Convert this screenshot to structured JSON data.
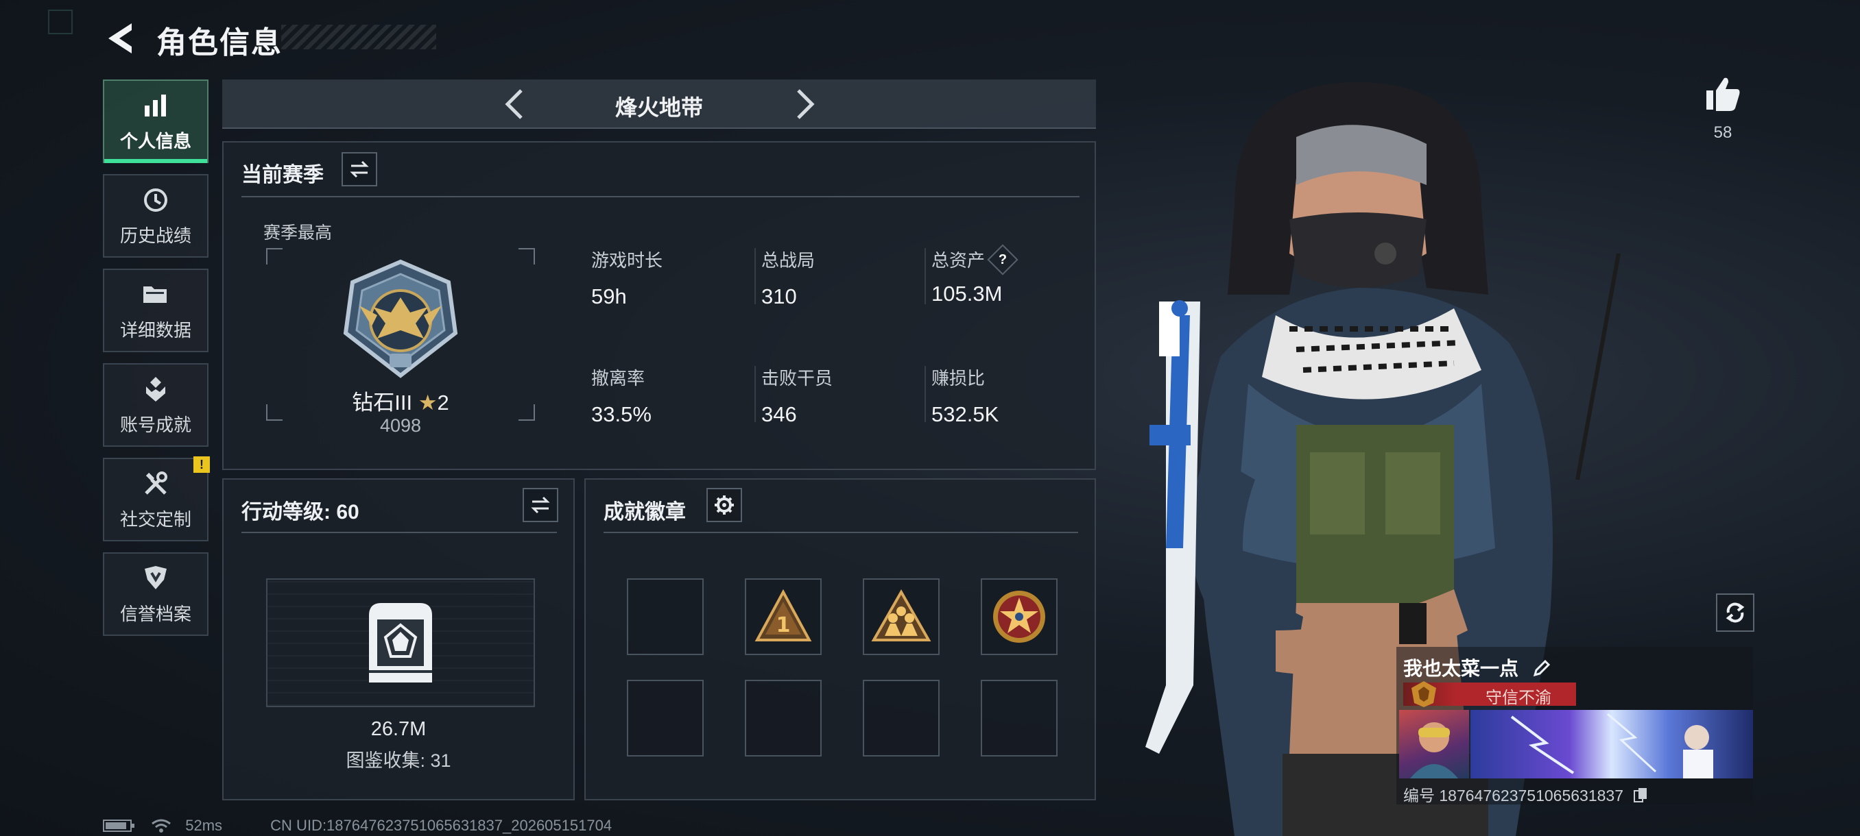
{
  "header": {
    "title": "角色信息"
  },
  "sidebar": {
    "items": [
      {
        "label": "个人信息",
        "icon": "bar-chart-icon",
        "active": true
      },
      {
        "label": "历史战绩",
        "icon": "clock-history-icon",
        "active": false
      },
      {
        "label": "详细数据",
        "icon": "folder-icon",
        "active": false
      },
      {
        "label": "账号成就",
        "icon": "achievement-icon",
        "active": false
      },
      {
        "label": "社交定制",
        "icon": "tools-icon",
        "active": false,
        "badge": "!"
      },
      {
        "label": "信誉档案",
        "icon": "shield-emblem-icon",
        "active": false
      }
    ]
  },
  "map_selector": {
    "name": "烽火地带"
  },
  "season": {
    "title": "当前赛季",
    "best_label": "赛季最高",
    "rank_name": "钻石III",
    "rank_stars": "2",
    "rank_points": "4098",
    "stats": [
      {
        "label": "游戏时长",
        "value": "59h"
      },
      {
        "label": "总战局",
        "value": "310"
      },
      {
        "label": "总资产",
        "value": "105.3M",
        "has_help": true,
        "help": "?"
      },
      {
        "label": "撤离率",
        "value": "33.5%"
      },
      {
        "label": "击败干员",
        "value": "346"
      },
      {
        "label": "赚损比",
        "value": "532.5K"
      }
    ]
  },
  "action_level": {
    "title": "行动等级: 60",
    "value": "26.7M",
    "collection": "图鉴收集: 31"
  },
  "achievements": {
    "title": "成就徽章",
    "badges": [
      "",
      "badge-rank-1",
      "badge-squad",
      "badge-star-medal",
      "",
      "",
      "",
      ""
    ]
  },
  "profile": {
    "likes": "58",
    "player_name": "我也太菜一点",
    "player_title": "守信不渝",
    "uid_label": "编号 187647623751065631837"
  },
  "status": {
    "ping": "52ms",
    "uid_line": "CN UID:187647623751065631837_202605151704"
  },
  "colors": {
    "accent_green": "#3fe09a",
    "warning_yellow": "#e9c51e",
    "title_red": "#b0262a"
  }
}
